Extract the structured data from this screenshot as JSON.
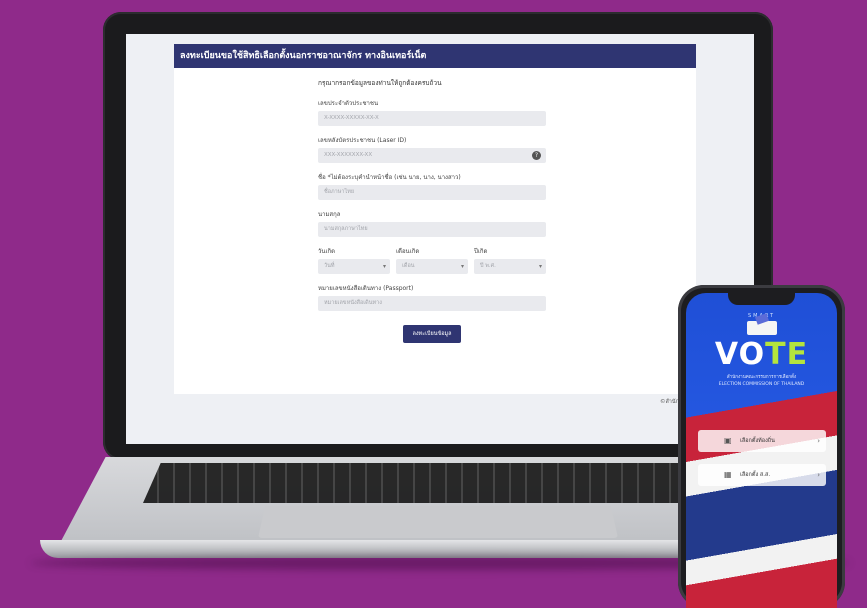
{
  "form": {
    "header_title": "ลงทะเบียนขอใช้สิทธิเลือกตั้งนอกราชอาณาจักร ทางอินเทอร์เน็ต",
    "intro": "กรุณากรอกข้อมูลของท่านให้ถูกต้องครบถ้วน",
    "fields": [
      {
        "label": "เลขประจำตัวประชาชน",
        "placeholder": "X-XXXX-XXXXX-XX-X"
      },
      {
        "label": "เลขหลังบัตรประชาชน (Laser ID)",
        "placeholder": "XXX-XXXXXXX-XX"
      },
      {
        "label": "ชื่อ *ไม่ต้องระบุคำนำหน้าชื่อ (เช่น นาย, นาง, นางสาว)",
        "placeholder": "ชื่อภาษาไทย"
      },
      {
        "label": "นามสกุล",
        "placeholder": "นามสกุลภาษาไทย"
      }
    ],
    "dob": {
      "day_label": "วันเกิด",
      "day_value": "วันที่",
      "month_label": "เดือนเกิด",
      "month_value": "เดือน",
      "year_label": "ปีเกิด",
      "year_value": "ปี พ.ศ."
    },
    "passport": {
      "label": "หมายเลขหนังสือเดินทาง (Passport)",
      "placeholder": "หมายเลขหนังสือเดินทาง"
    },
    "submit_label": "ลงทะเบียนข้อมูล",
    "footer": "©สำนักงานคณะกรรมการการเลือกตั้ง"
  },
  "phone": {
    "smart_label": "SMART",
    "vote_title_main": "VO",
    "vote_title_accent": "TE",
    "subtitle_th": "สำนักงานคณะกรรมการการเลือกตั้ง",
    "subtitle_en": "ELECTION COMMISSION OF THAILAND",
    "buttons": [
      {
        "icon": "ballot-icon",
        "label": "เลือกตั้งท้องถิ่น"
      },
      {
        "icon": "calendar-icon",
        "label": "เลือกตั้ง ส.ส."
      }
    ]
  },
  "colors": {
    "background": "#8f2a8a",
    "header": "#2f3572",
    "vote_accent": "#b4e43d"
  }
}
